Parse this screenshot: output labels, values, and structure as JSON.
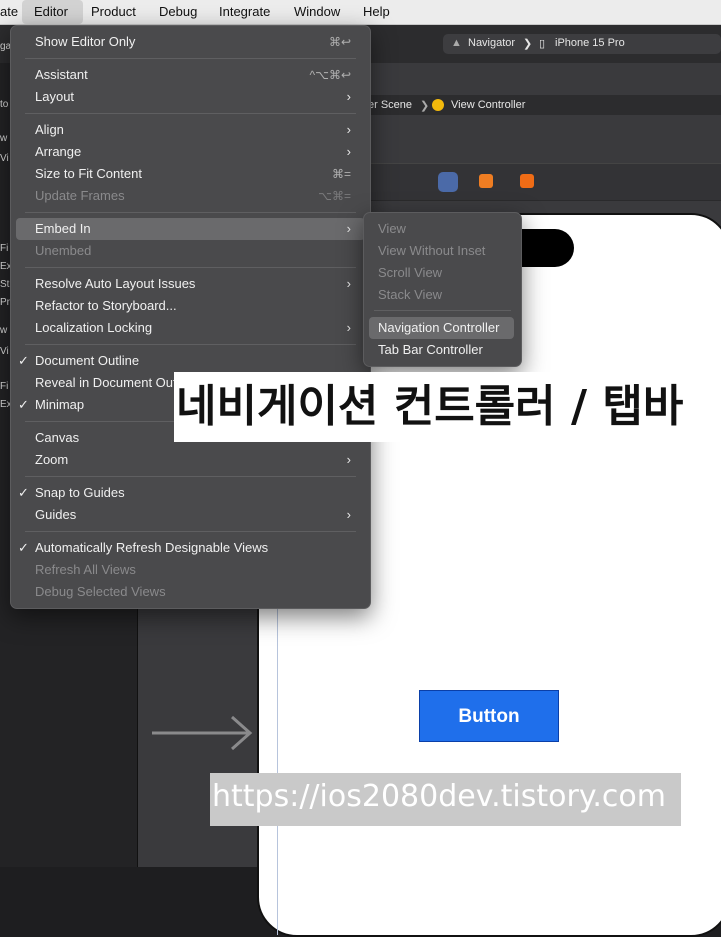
{
  "menubar": {
    "items": [
      "ate",
      "Editor",
      "Product",
      "Debug",
      "Integrate",
      "Window",
      "Help"
    ]
  },
  "toolbar": {
    "scheme_label": "Navigator",
    "device_label": "iPhone 15 Pro"
  },
  "breadcrumb": {
    "scene": "er Scene",
    "controller": "View Controller"
  },
  "left_nav": {
    "fragments": [
      "ga",
      "to",
      "w",
      "Vi",
      "Fi",
      "Ex",
      "St",
      "Pr",
      "w",
      "Vi",
      "Fi",
      "Ex"
    ]
  },
  "editor_menu": {
    "items": [
      {
        "label": "Show Editor Only",
        "shortcut": "⌘↩"
      },
      {
        "label": "Assistant",
        "shortcut": "^⌥⌘↩"
      },
      {
        "label": "Layout",
        "submenu": true
      },
      {
        "label": "Align",
        "submenu": true
      },
      {
        "label": "Arrange",
        "submenu": true
      },
      {
        "label": "Size to Fit Content",
        "shortcut": "⌘="
      },
      {
        "label": "Update Frames",
        "shortcut": "⌥⌘=",
        "disabled": true
      },
      {
        "label": "Embed In",
        "submenu": true,
        "highlighted": true
      },
      {
        "label": "Unembed",
        "disabled": true
      },
      {
        "label": "Resolve Auto Layout Issues",
        "submenu": true
      },
      {
        "label": "Refactor to Storyboard..."
      },
      {
        "label": "Localization Locking",
        "submenu": true
      },
      {
        "label": "Document Outline",
        "checked": true
      },
      {
        "label": "Reveal in Document Outline"
      },
      {
        "label": "Minimap",
        "checked": true
      },
      {
        "label": "Canvas"
      },
      {
        "label": "Zoom",
        "submenu": true
      },
      {
        "label": "Snap to Guides",
        "checked": true
      },
      {
        "label": "Guides",
        "submenu": true
      },
      {
        "label": "Automatically Refresh Designable Views",
        "checked": true
      },
      {
        "label": "Refresh All Views",
        "disabled": true
      },
      {
        "label": "Debug Selected Views",
        "disabled": true
      }
    ]
  },
  "embed_submenu": {
    "items": [
      {
        "label": "View",
        "disabled": true
      },
      {
        "label": "View Without Inset",
        "disabled": true
      },
      {
        "label": "Scroll View",
        "disabled": true
      },
      {
        "label": "Stack View",
        "disabled": true
      },
      {
        "label": "Navigation Controller",
        "highlighted": true
      },
      {
        "label": "Tab Bar Controller"
      }
    ]
  },
  "canvas": {
    "button_label": "Button"
  },
  "overlay": {
    "title": "네비게이션 컨트롤러 / 탭바",
    "url": "https://ios2080dev.tistory.com"
  },
  "colors": {
    "accent": "#1f6feb",
    "menu_bg": "#4a4a4c",
    "menubar_bg": "#ececec"
  }
}
